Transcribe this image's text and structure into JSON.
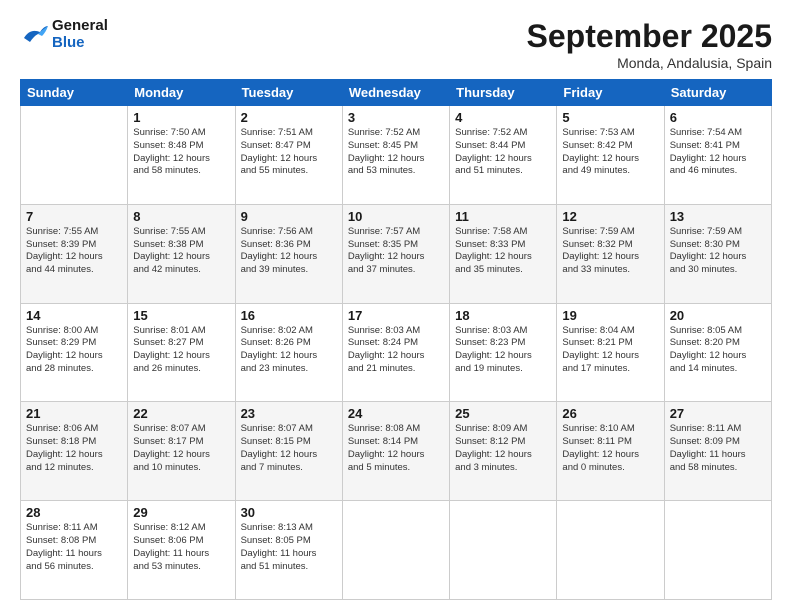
{
  "logo": {
    "line1": "General",
    "line2": "Blue"
  },
  "title": "September 2025",
  "location": "Monda, Andalusia, Spain",
  "weekdays": [
    "Sunday",
    "Monday",
    "Tuesday",
    "Wednesday",
    "Thursday",
    "Friday",
    "Saturday"
  ],
  "weeks": [
    [
      {
        "day": "",
        "info": ""
      },
      {
        "day": "1",
        "info": "Sunrise: 7:50 AM\nSunset: 8:48 PM\nDaylight: 12 hours\nand 58 minutes."
      },
      {
        "day": "2",
        "info": "Sunrise: 7:51 AM\nSunset: 8:47 PM\nDaylight: 12 hours\nand 55 minutes."
      },
      {
        "day": "3",
        "info": "Sunrise: 7:52 AM\nSunset: 8:45 PM\nDaylight: 12 hours\nand 53 minutes."
      },
      {
        "day": "4",
        "info": "Sunrise: 7:52 AM\nSunset: 8:44 PM\nDaylight: 12 hours\nand 51 minutes."
      },
      {
        "day": "5",
        "info": "Sunrise: 7:53 AM\nSunset: 8:42 PM\nDaylight: 12 hours\nand 49 minutes."
      },
      {
        "day": "6",
        "info": "Sunrise: 7:54 AM\nSunset: 8:41 PM\nDaylight: 12 hours\nand 46 minutes."
      }
    ],
    [
      {
        "day": "7",
        "info": "Sunrise: 7:55 AM\nSunset: 8:39 PM\nDaylight: 12 hours\nand 44 minutes."
      },
      {
        "day": "8",
        "info": "Sunrise: 7:55 AM\nSunset: 8:38 PM\nDaylight: 12 hours\nand 42 minutes."
      },
      {
        "day": "9",
        "info": "Sunrise: 7:56 AM\nSunset: 8:36 PM\nDaylight: 12 hours\nand 39 minutes."
      },
      {
        "day": "10",
        "info": "Sunrise: 7:57 AM\nSunset: 8:35 PM\nDaylight: 12 hours\nand 37 minutes."
      },
      {
        "day": "11",
        "info": "Sunrise: 7:58 AM\nSunset: 8:33 PM\nDaylight: 12 hours\nand 35 minutes."
      },
      {
        "day": "12",
        "info": "Sunrise: 7:59 AM\nSunset: 8:32 PM\nDaylight: 12 hours\nand 33 minutes."
      },
      {
        "day": "13",
        "info": "Sunrise: 7:59 AM\nSunset: 8:30 PM\nDaylight: 12 hours\nand 30 minutes."
      }
    ],
    [
      {
        "day": "14",
        "info": "Sunrise: 8:00 AM\nSunset: 8:29 PM\nDaylight: 12 hours\nand 28 minutes."
      },
      {
        "day": "15",
        "info": "Sunrise: 8:01 AM\nSunset: 8:27 PM\nDaylight: 12 hours\nand 26 minutes."
      },
      {
        "day": "16",
        "info": "Sunrise: 8:02 AM\nSunset: 8:26 PM\nDaylight: 12 hours\nand 23 minutes."
      },
      {
        "day": "17",
        "info": "Sunrise: 8:03 AM\nSunset: 8:24 PM\nDaylight: 12 hours\nand 21 minutes."
      },
      {
        "day": "18",
        "info": "Sunrise: 8:03 AM\nSunset: 8:23 PM\nDaylight: 12 hours\nand 19 minutes."
      },
      {
        "day": "19",
        "info": "Sunrise: 8:04 AM\nSunset: 8:21 PM\nDaylight: 12 hours\nand 17 minutes."
      },
      {
        "day": "20",
        "info": "Sunrise: 8:05 AM\nSunset: 8:20 PM\nDaylight: 12 hours\nand 14 minutes."
      }
    ],
    [
      {
        "day": "21",
        "info": "Sunrise: 8:06 AM\nSunset: 8:18 PM\nDaylight: 12 hours\nand 12 minutes."
      },
      {
        "day": "22",
        "info": "Sunrise: 8:07 AM\nSunset: 8:17 PM\nDaylight: 12 hours\nand 10 minutes."
      },
      {
        "day": "23",
        "info": "Sunrise: 8:07 AM\nSunset: 8:15 PM\nDaylight: 12 hours\nand 7 minutes."
      },
      {
        "day": "24",
        "info": "Sunrise: 8:08 AM\nSunset: 8:14 PM\nDaylight: 12 hours\nand 5 minutes."
      },
      {
        "day": "25",
        "info": "Sunrise: 8:09 AM\nSunset: 8:12 PM\nDaylight: 12 hours\nand 3 minutes."
      },
      {
        "day": "26",
        "info": "Sunrise: 8:10 AM\nSunset: 8:11 PM\nDaylight: 12 hours\nand 0 minutes."
      },
      {
        "day": "27",
        "info": "Sunrise: 8:11 AM\nSunset: 8:09 PM\nDaylight: 11 hours\nand 58 minutes."
      }
    ],
    [
      {
        "day": "28",
        "info": "Sunrise: 8:11 AM\nSunset: 8:08 PM\nDaylight: 11 hours\nand 56 minutes."
      },
      {
        "day": "29",
        "info": "Sunrise: 8:12 AM\nSunset: 8:06 PM\nDaylight: 11 hours\nand 53 minutes."
      },
      {
        "day": "30",
        "info": "Sunrise: 8:13 AM\nSunset: 8:05 PM\nDaylight: 11 hours\nand 51 minutes."
      },
      {
        "day": "",
        "info": ""
      },
      {
        "day": "",
        "info": ""
      },
      {
        "day": "",
        "info": ""
      },
      {
        "day": "",
        "info": ""
      }
    ]
  ]
}
